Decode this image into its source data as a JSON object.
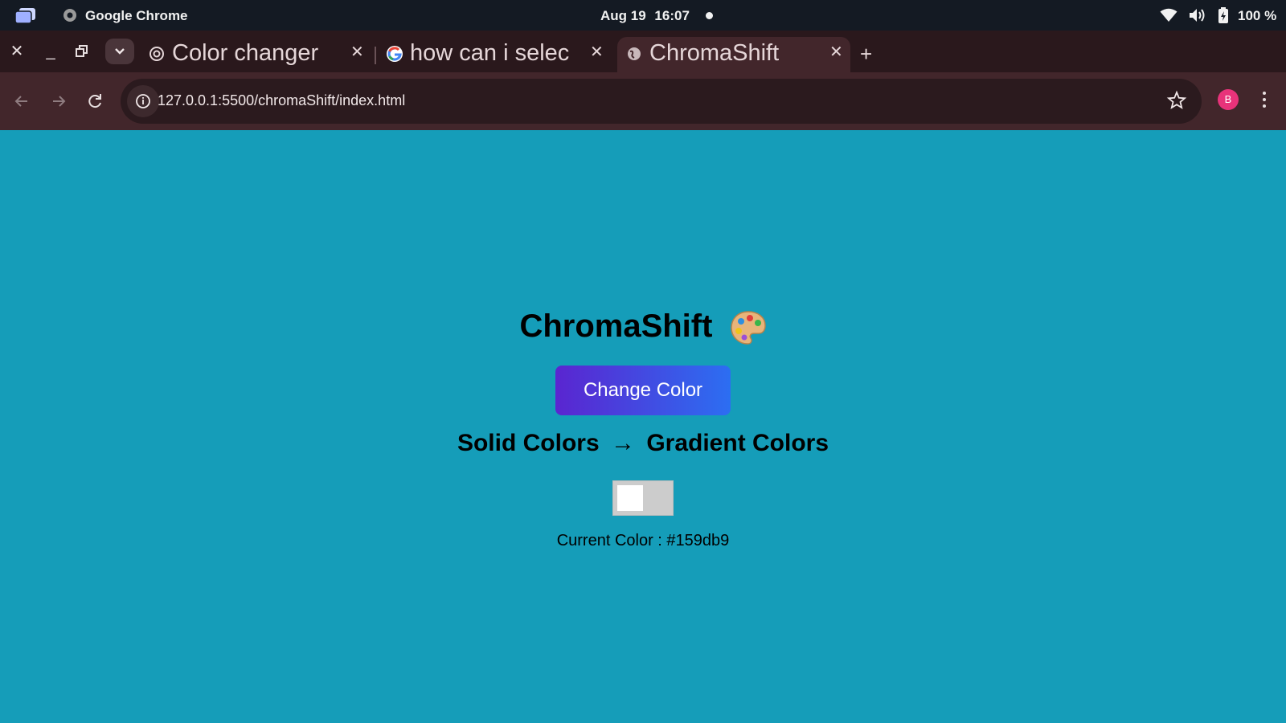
{
  "system_bar": {
    "app_name": "Google Chrome",
    "date": "Aug 19",
    "time": "16:07",
    "battery": "100 %"
  },
  "browser": {
    "tabs": [
      {
        "title": "Color changer",
        "favicon": "openai-icon",
        "active": false
      },
      {
        "title": "how can i selec",
        "favicon": "google-icon",
        "active": false
      },
      {
        "title": "ChromaShift",
        "favicon": "globe-icon",
        "active": true
      }
    ],
    "url": "127.0.0.1:5500/chromaShift/index.html",
    "profile_initial": "B"
  },
  "page": {
    "background_color": "#159db9",
    "title": "ChromaShift",
    "change_button_label": "Change Color",
    "mode_left": "Solid Colors",
    "mode_arrow": "→",
    "mode_right": "Gradient Colors",
    "gradient_toggle_on": false,
    "current_color_label": "Current Color : #159db9"
  },
  "colors": {
    "topbar": "#141a23",
    "tabstrip": "#2a181c",
    "toolbar": "#42262b",
    "button_gradient_start": "#5a25d0",
    "button_gradient_end": "#2c6ef2"
  }
}
